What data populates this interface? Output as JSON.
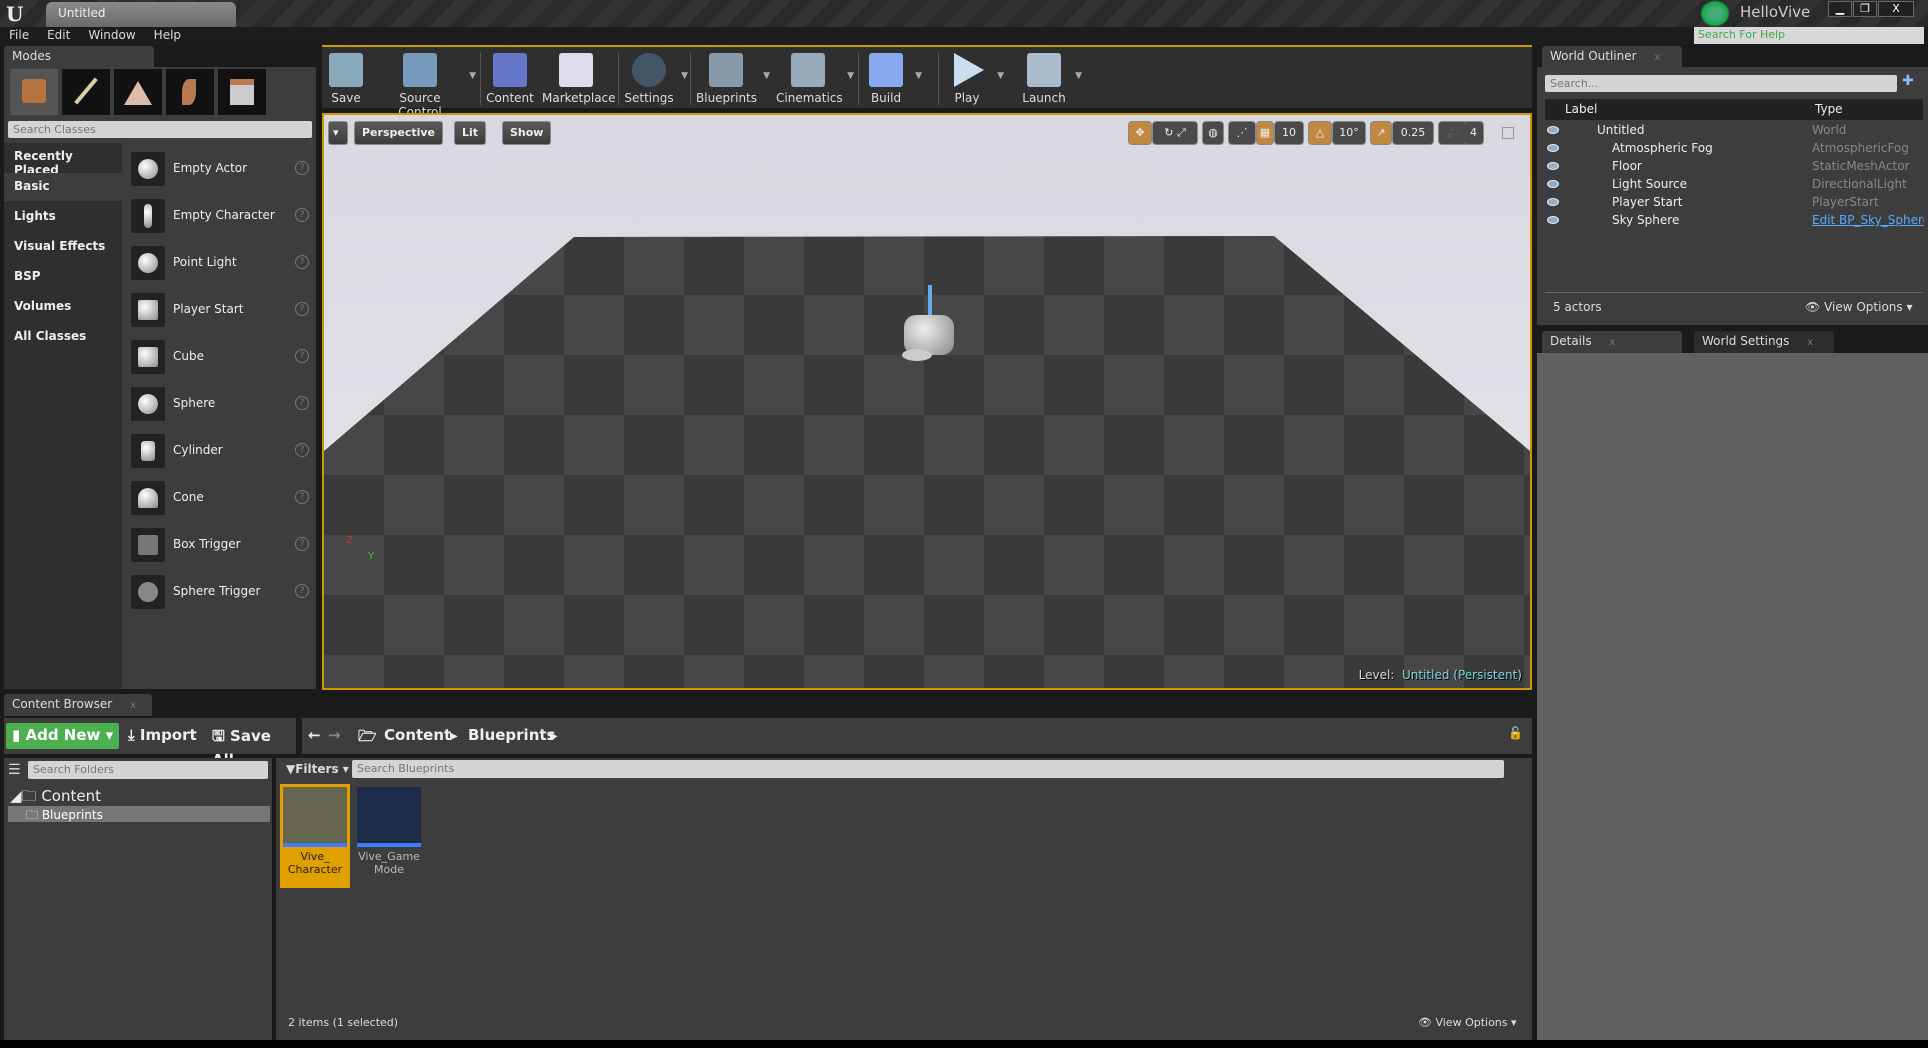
{
  "window": {
    "doc_tab": "Untitled",
    "project": "HelloVive",
    "help_search_placeholder": "Search For Help",
    "minimize": "▁",
    "restore": "❐",
    "close": "X"
  },
  "menu": [
    "File",
    "Edit",
    "Window",
    "Help"
  ],
  "modes": {
    "tab": "Modes",
    "search_placeholder": "Search Classes",
    "categories": [
      "Recently Placed",
      "Basic",
      "Lights",
      "Visual Effects",
      "BSP",
      "Volumes",
      "All Classes"
    ],
    "selected_category": "Basic",
    "items": [
      "Empty Actor",
      "Empty Character",
      "Point Light",
      "Player Start",
      "Cube",
      "Sphere",
      "Cylinder",
      "Cone",
      "Box Trigger",
      "Sphere Trigger"
    ],
    "help": "?"
  },
  "toolbar": [
    "Save",
    "Source Control",
    "Content",
    "Marketplace",
    "Settings",
    "Blueprints",
    "Cinematics",
    "Build",
    "Play",
    "Launch"
  ],
  "viewport": {
    "perspective": "Perspective",
    "lit": "Lit",
    "show": "Show",
    "grid_snap": "10",
    "rotation_snap": "10°",
    "scale_snap": "0.25",
    "camera_speed": "4",
    "level_label": "Level:",
    "level_name": "Untitled (Persistent)",
    "axis_z": "Z",
    "axis_y": "Y",
    "level_color": "#7fd8e8"
  },
  "outliner": {
    "tab": "World Outliner",
    "search_placeholder": "Search...",
    "col_label": "Label",
    "col_type": "Type",
    "rows": [
      {
        "label": "Untitled",
        "type": "World"
      },
      {
        "label": "Atmospheric Fog",
        "type": "AtmosphericFog"
      },
      {
        "label": "Floor",
        "type": "StaticMeshActor"
      },
      {
        "label": "Light Source",
        "type": "DirectionalLight"
      },
      {
        "label": "Player Start",
        "type": "PlayerStart"
      },
      {
        "label": "Sky Sphere",
        "type": "Edit BP_Sky_Sphere"
      }
    ],
    "count": "5 actors",
    "view_options": "View Options"
  },
  "details": {
    "tab": "Details",
    "world_settings_tab": "World Settings"
  },
  "content_browser": {
    "tab": "Content Browser",
    "add_new": "Add New",
    "import": "Import",
    "save_all": "Save All",
    "path": [
      "Content",
      "Blueprints"
    ],
    "folder_search_placeholder": "Search Folders",
    "filters": "Filters",
    "asset_search_placeholder": "Search Blueprints",
    "tree": [
      "Content",
      "Blueprints"
    ],
    "assets": [
      {
        "name": "Vive_ Character",
        "selected": true
      },
      {
        "name": "Vive_Game Mode",
        "selected": false
      }
    ],
    "status": "2 items (1 selected)",
    "view_options": "View Options",
    "accent": "#e0a000",
    "add_color": "#4caf50"
  }
}
